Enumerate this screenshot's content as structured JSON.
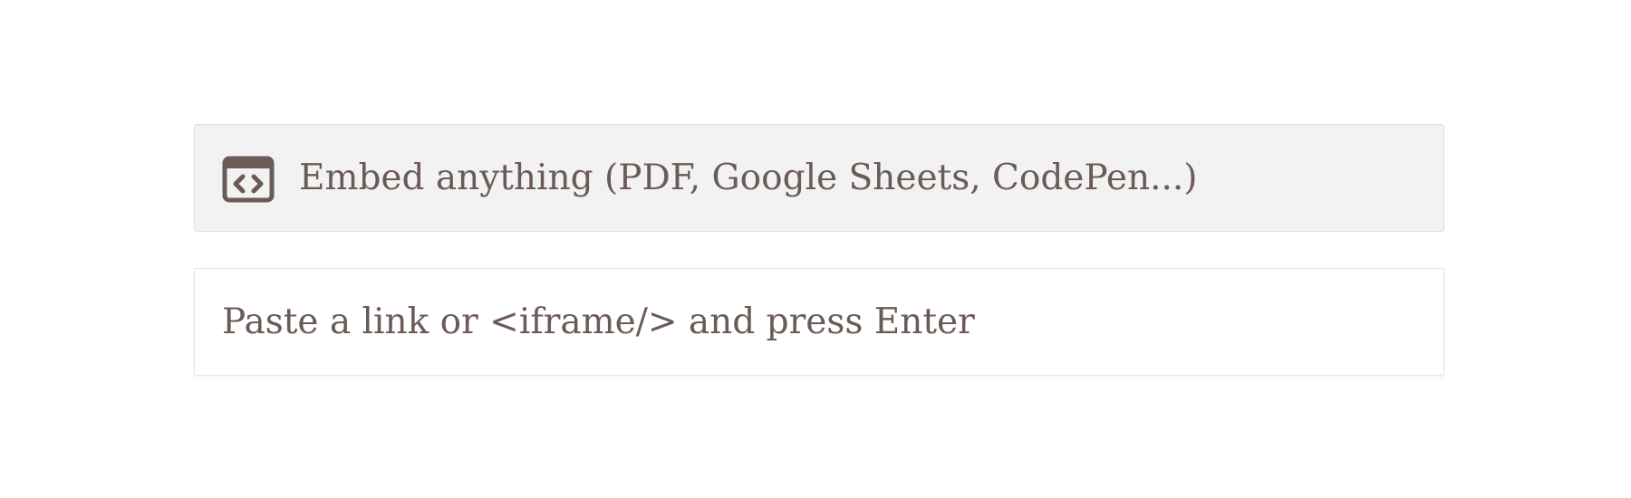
{
  "embed": {
    "icon": "code-window-icon",
    "label": "Embed anything (PDF, Google Sheets, CodePen...)"
  },
  "link_input": {
    "value": "",
    "placeholder": "Paste a link or <iframe/> and press Enter"
  },
  "colors": {
    "text": "#6b5b57",
    "embed_background": "#f2f2f2",
    "border": "#dedede"
  }
}
